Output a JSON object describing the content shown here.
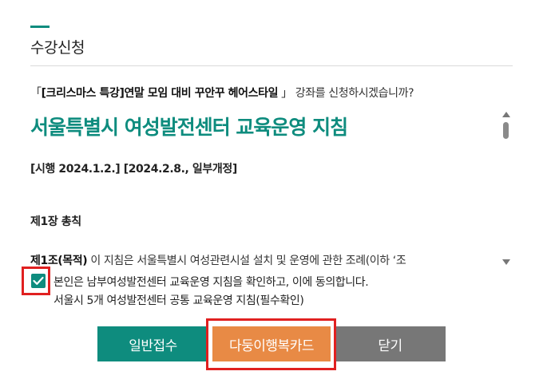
{
  "dialog": {
    "title": "수강신청"
  },
  "question": {
    "prefix": "「",
    "course": "[크리스마스 특강]연말 모임 대비 꾸안꾸 헤어스타일",
    "suffix": " 」 강좌를 신청하시겠습니까?"
  },
  "document": {
    "heading": "서울특별시 여성발전센터 교육운영 지침",
    "version": "[시행 2024.1.2.] [2024.2.8., 일부개정]",
    "chapter": "제1장 총칙",
    "article_title": "제1조(목적)",
    "article_text": " 이 지침은 서울특별시 여성관련시설 설치 및 운영에 관한 조례(이하 ‘조"
  },
  "agreement": {
    "checked": true,
    "label": "본인은 남부여성발전센터 교육운영 지침을 확인하고, 이에 동의합니다.",
    "sublabel": "서울시 5개 여성발전센터 공통 교육운영 지침(필수확인)"
  },
  "buttons": {
    "general": "일반접수",
    "card": "다둥이행복카드",
    "close": "닫기"
  },
  "colors": {
    "accent": "#0e8c7e",
    "card_button": "#e88a45",
    "close_button": "#777777",
    "highlight_box": "#e02020"
  }
}
